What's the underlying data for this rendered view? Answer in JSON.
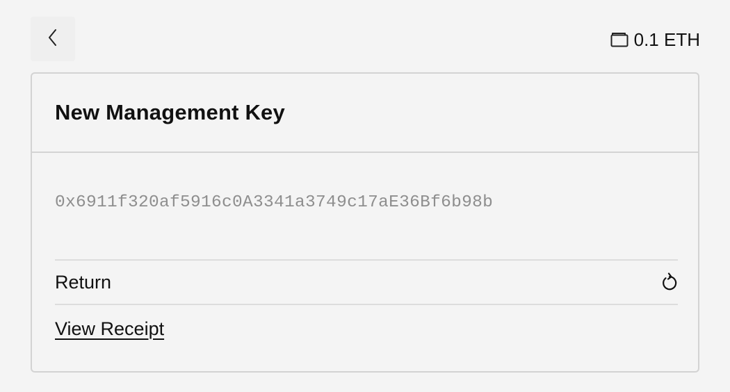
{
  "header": {
    "back_icon": "chevron-left-icon",
    "balance_icon": "wallet-icon",
    "balance_text": "0.1 ETH"
  },
  "card": {
    "title": "New Management Key",
    "address": "0x6911f320af5916c0A3341a3749c17aE36Bf6b98b",
    "return_label": "Return",
    "return_icon": "rotate-ccw-icon",
    "receipt_label": "View Receipt"
  },
  "colors": {
    "background": "#f4f4f4",
    "border": "#d3d3d3",
    "address_text": "#8e8e8e",
    "text": "#111111"
  }
}
